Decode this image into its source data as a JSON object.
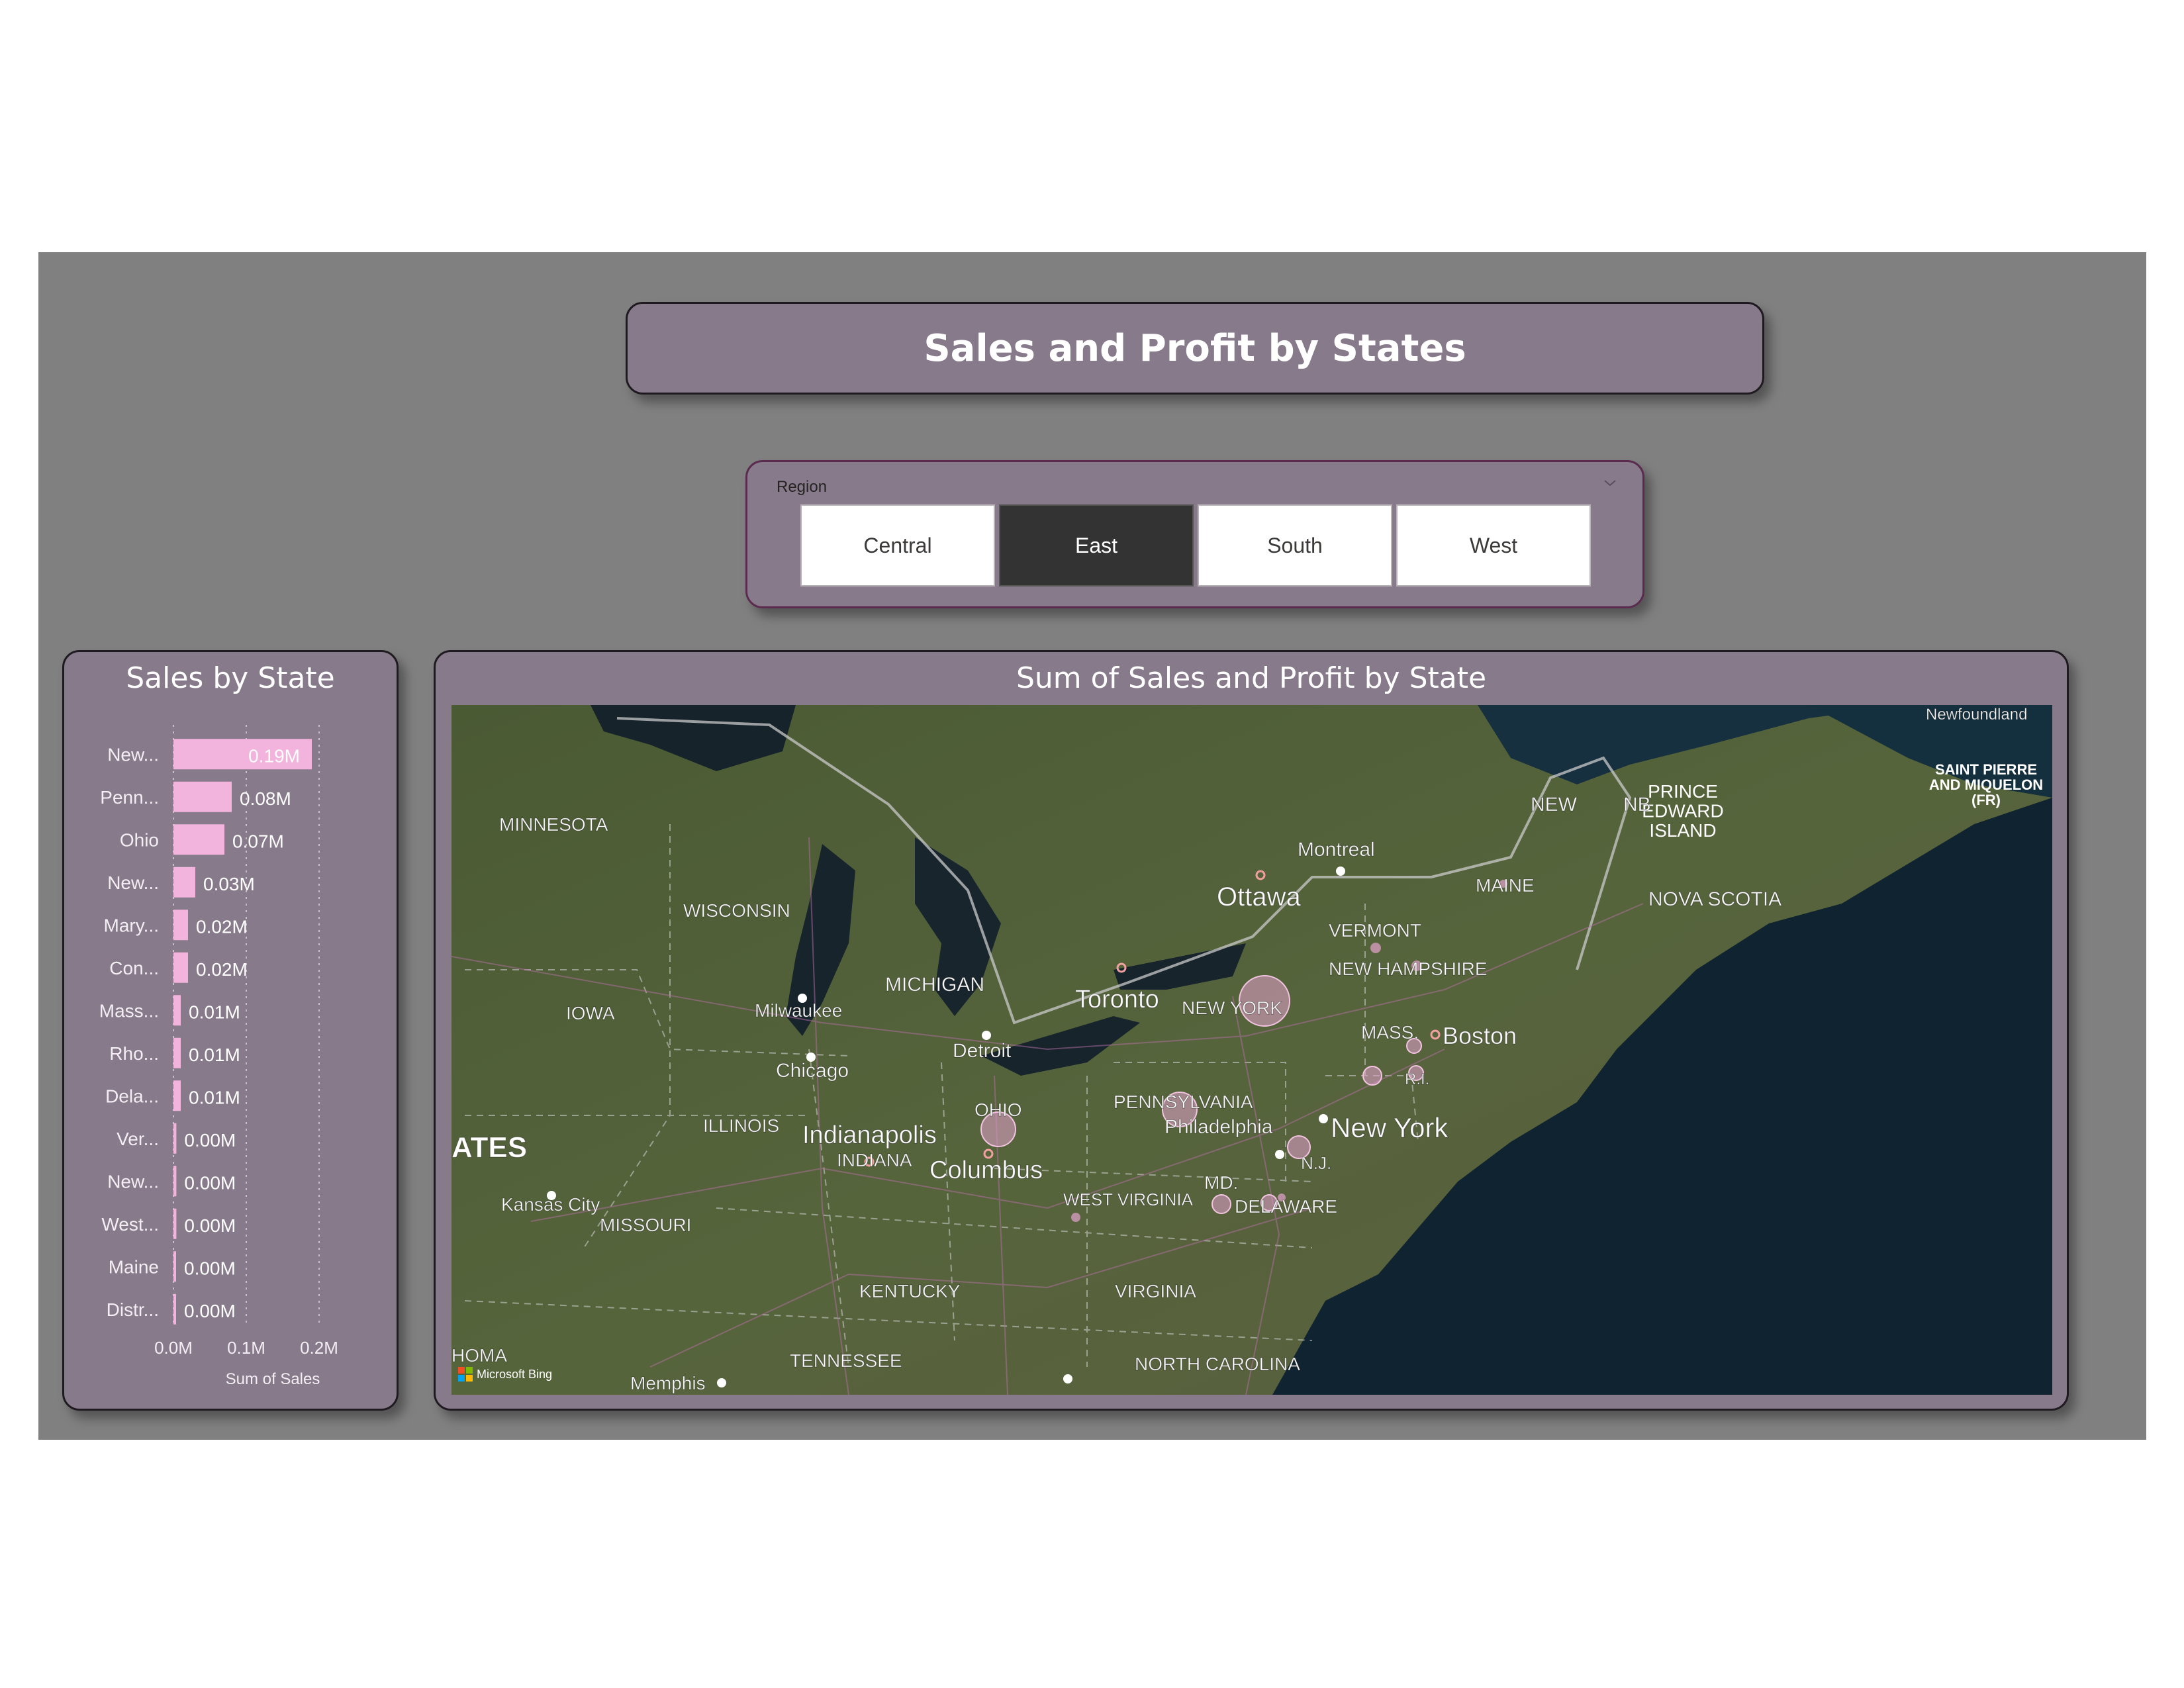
{
  "header": {
    "title": "Sales and Profit by States"
  },
  "slicer": {
    "label": "Region",
    "options": [
      {
        "label": "Central",
        "selected": false
      },
      {
        "label": "East",
        "selected": true
      },
      {
        "label": "South",
        "selected": false
      },
      {
        "label": "West",
        "selected": false
      }
    ]
  },
  "bar_visual": {
    "title": "Sales by State"
  },
  "map_visual": {
    "title": "Sum of Sales and Profit by State",
    "attribution": "Microsoft Bing",
    "place_labels": [
      "MINNESOTA",
      "WISCONSIN",
      "IOWA",
      "ILLINOIS",
      "MISSOURI",
      "MICHIGAN",
      "INDIANA",
      "OHIO",
      "KENTUCKY",
      "TENNESSEE",
      "WEST VIRGINIA",
      "VIRGINIA",
      "NORTH CAROLINA",
      "PENNSYLVANIA",
      "NEW YORK",
      "VERMONT",
      "NEW HAMPSHIRE",
      "MAINE",
      "MASS.",
      "R.I.",
      "N.J.",
      "MD.",
      "DELAWARE",
      "Milwaukee",
      "Chicago",
      "Detroit",
      "Toronto",
      "Ottawa",
      "Montreal",
      "Boston",
      "New York",
      "Philadelphia",
      "Indianapolis",
      "Columbus",
      "Kansas City",
      "Memphis",
      "NOVA SCOTIA",
      "PRINCE EDWARD ISLAND",
      "NB",
      "NEW",
      "Newfoundland",
      "SAINT PIERRE AND MIQUELON (FR)",
      "ATES",
      "HOMA"
    ],
    "bubble_color": "#e6a3cf"
  },
  "chart_data": {
    "type": "bar",
    "orientation": "horizontal",
    "title": "Sales by State",
    "categories": [
      "New...",
      "Penn...",
      "Ohio",
      "New...",
      "Mary...",
      "Con...",
      "Mass...",
      "Rho...",
      "Dela...",
      "Ver...",
      "New...",
      "West...",
      "Maine",
      "Distr..."
    ],
    "values": [
      0.19,
      0.08,
      0.07,
      0.03,
      0.02,
      0.02,
      0.01,
      0.01,
      0.01,
      0.004,
      0.004,
      0.004,
      0.003,
      0.003
    ],
    "data_labels": [
      "0.19M",
      "0.08M",
      "0.07M",
      "0.03M",
      "0.02M",
      "0.02M",
      "0.01M",
      "0.01M",
      "0.01M",
      "0.00M",
      "0.00M",
      "0.00M",
      "0.00M",
      "0.00M"
    ],
    "xlim": [
      0,
      0.2
    ],
    "x_ticks": [
      "0.0M",
      "0.1M",
      "0.2M"
    ],
    "xlabel": "Sum of Sales",
    "ylabel": "",
    "bar_color": "#f2b3dd",
    "grid": true
  }
}
